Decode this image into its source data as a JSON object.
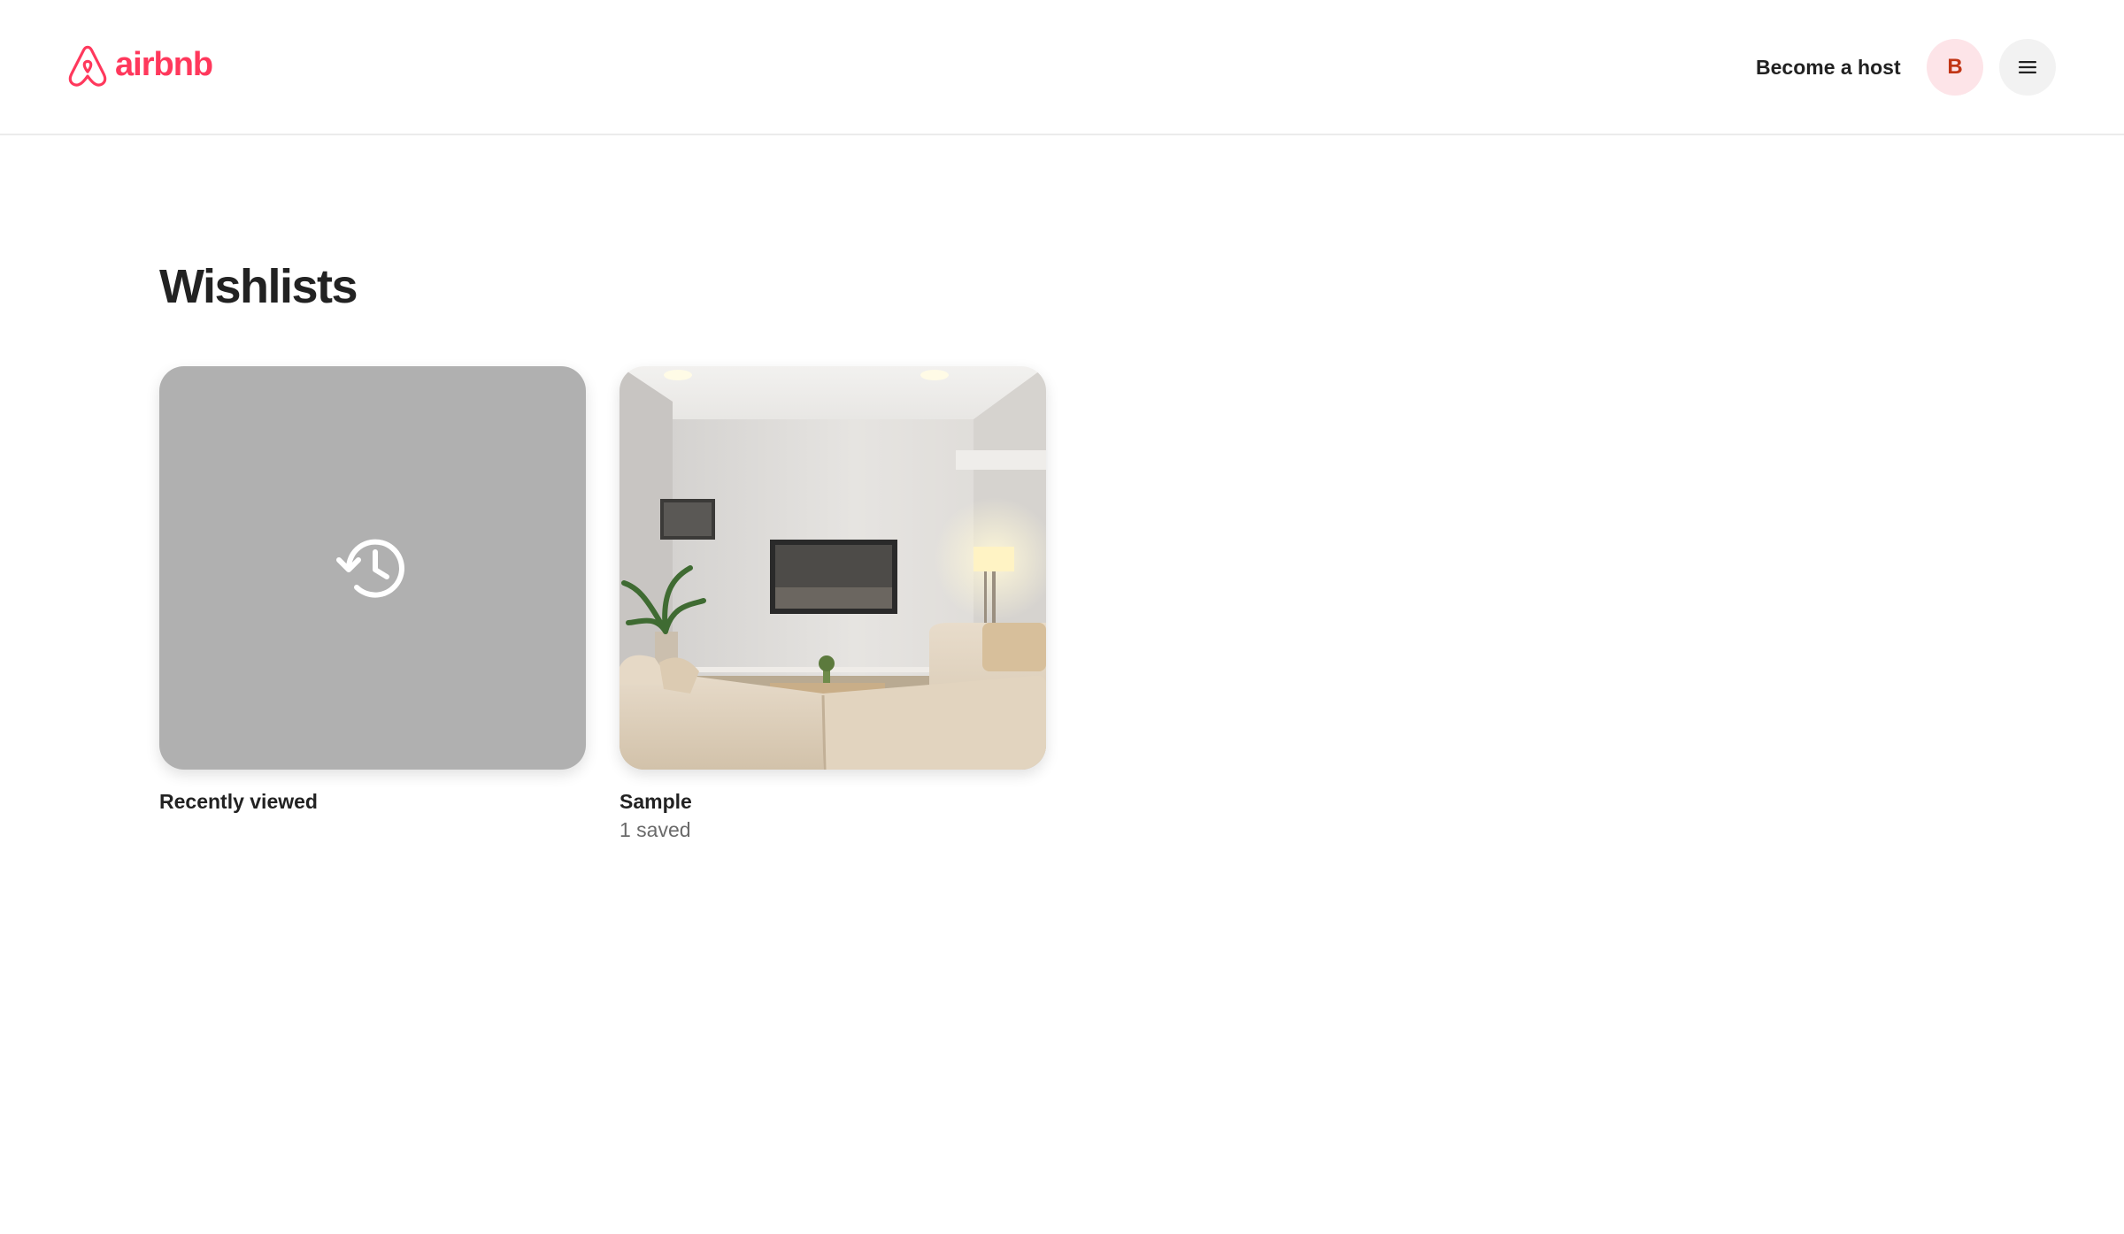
{
  "header": {
    "brand": "airbnb",
    "become_host": "Become a host",
    "avatar_initial": "B",
    "brand_color": "#ff385c"
  },
  "main": {
    "title": "Wishlists",
    "wishlists": [
      {
        "name": "Recently viewed",
        "subtitle": "",
        "thumbnail_icon": "history-icon"
      },
      {
        "name": "Sample",
        "subtitle": "1 saved",
        "thumbnail_icon": "living-room-photo"
      }
    ]
  }
}
